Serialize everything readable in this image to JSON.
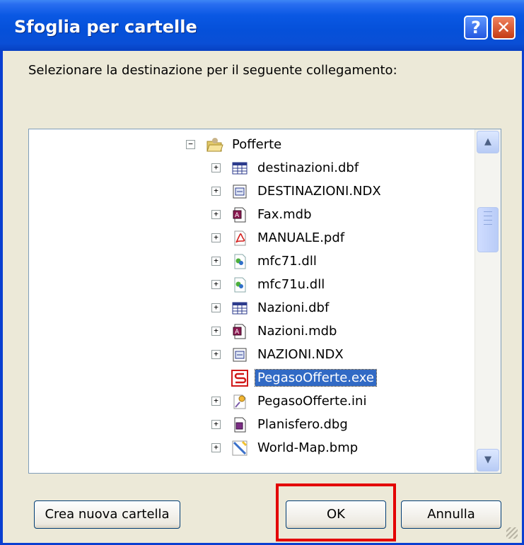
{
  "window": {
    "title": "Sfoglia per cartelle"
  },
  "titlebar_buttons": {
    "help": "?",
    "close": "✕"
  },
  "prompt": "Selezionare la destinazione per il seguente collegamento:",
  "tree": {
    "root": {
      "label": "Pofferte",
      "icon": "folder-open-icon",
      "expander": "−"
    },
    "items": [
      {
        "label": "destinazioni.dbf",
        "icon": "table-file-icon",
        "expander": "+"
      },
      {
        "label": "DESTINAZIONI.NDX",
        "icon": "index-file-icon",
        "expander": "+"
      },
      {
        "label": "Fax.mdb",
        "icon": "access-db-icon",
        "expander": "+"
      },
      {
        "label": "MANUALE.pdf",
        "icon": "pdf-icon",
        "expander": "+"
      },
      {
        "label": "mfc71.dll",
        "icon": "dll-icon",
        "expander": "+"
      },
      {
        "label": "mfc71u.dll",
        "icon": "dll-icon",
        "expander": "+"
      },
      {
        "label": "Nazioni.dbf",
        "icon": "table-file-icon",
        "expander": "+"
      },
      {
        "label": "Nazioni.mdb",
        "icon": "access-db-icon",
        "expander": "+"
      },
      {
        "label": "NAZIONI.NDX",
        "icon": "index-file-icon",
        "expander": "+"
      },
      {
        "label": "PegasoOfferte.exe",
        "icon": "exe-app-icon",
        "expander": "",
        "selected": true
      },
      {
        "label": "PegasoOfferte.ini",
        "icon": "ini-settings-icon",
        "expander": "+"
      },
      {
        "label": "Planisfero.dbg",
        "icon": "dbg-file-icon",
        "expander": "+"
      },
      {
        "label": "World-Map.bmp",
        "icon": "bitmap-image-icon",
        "expander": "+"
      }
    ]
  },
  "scrollbar": {
    "up": "▲",
    "down": "▼"
  },
  "buttons": {
    "new_folder": "Crea nuova cartella",
    "ok": "OK",
    "cancel": "Annulla"
  },
  "colors": {
    "titlebar": "#0a58e3",
    "selection": "#316ac5",
    "highlight_box": "#e30000",
    "dialog_bg": "#ece9d8"
  }
}
